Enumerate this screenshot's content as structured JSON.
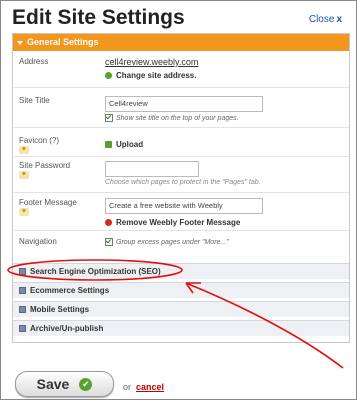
{
  "dialog": {
    "title": "Edit Site Settings",
    "close_label": "Close",
    "close_icon": "x"
  },
  "general": {
    "header": "General Settings",
    "address": {
      "label": "Address",
      "url": "cell4review.weebly.com",
      "change_link": "Change site address."
    },
    "site_title": {
      "label": "Site Title",
      "value": "Cell4review",
      "checkbox_label": "Show site title on the top of your pages."
    },
    "favicon": {
      "label": "Favicon (?)",
      "upload_label": "Upload"
    },
    "site_password": {
      "label": "Site Password",
      "value": "",
      "hint": "Choose which pages to protect in the \"Pages\" tab."
    },
    "footer_message": {
      "label": "Footer Message",
      "value": "Create a free website with Weebly",
      "remove_link": "Remove Weebly Footer Message"
    },
    "navigation": {
      "label": "Navigation",
      "checkbox_label": "Group excess pages under \"More...\""
    }
  },
  "sections": [
    {
      "label": "Search Engine Optimization (SEO)"
    },
    {
      "label": "Ecommerce Settings"
    },
    {
      "label": "Mobile Settings"
    },
    {
      "label": "Archive/Un-publish"
    }
  ],
  "footer": {
    "save_label": "Save",
    "or_text": "or",
    "cancel_label": "cancel"
  },
  "colors": {
    "header_orange": "#f3961d",
    "link_blue": "#1a56b8",
    "annotation_red": "#e01010",
    "save_check_green": "#57a12d"
  }
}
